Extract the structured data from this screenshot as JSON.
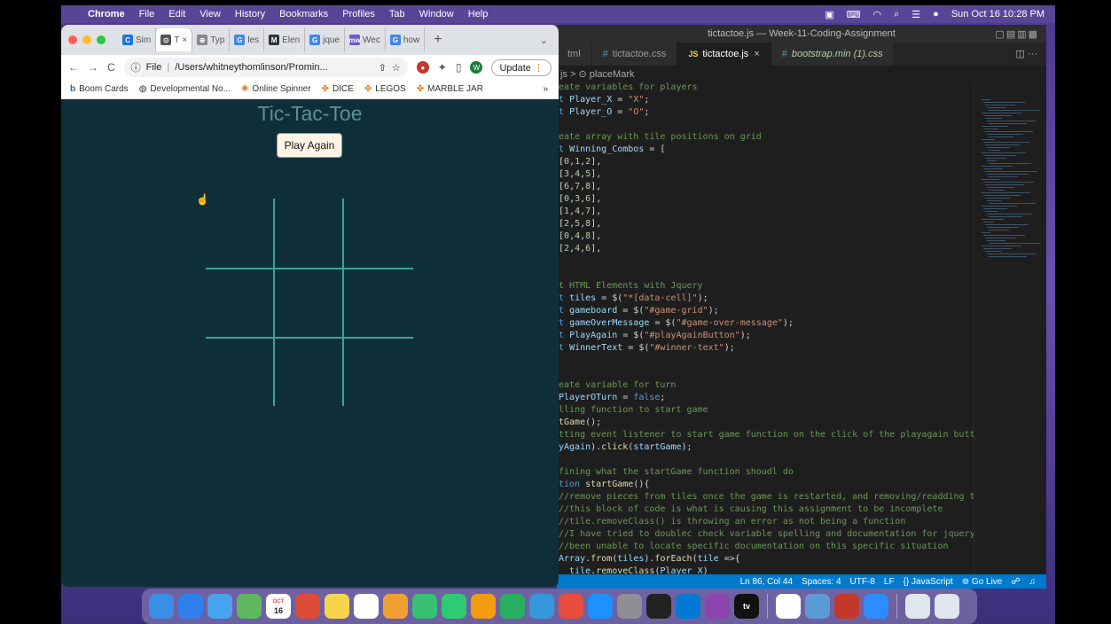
{
  "menubar": {
    "app": "Chrome",
    "items": [
      "File",
      "Edit",
      "View",
      "History",
      "Bookmarks",
      "Profiles",
      "Tab",
      "Window",
      "Help"
    ],
    "datetime": "Sun Oct 16  10:28 PM"
  },
  "vscode": {
    "window_title": "tictactoe.js — Week-11-Coding-Assignment",
    "tabs": [
      {
        "label": "tml",
        "active": false
      },
      {
        "label": "tictactoe.css",
        "active": false
      },
      {
        "label": "tictactoe.js",
        "active": true
      },
      {
        "label": "bootstrap.min (1).css",
        "active": false
      }
    ],
    "breadcrumb": "js > ⊙ placeMark",
    "code_lines": [
      "eate variables for players",
      "t Player_X = \"X\";",
      "t Player_O = \"O\";",
      "",
      "eate array with tile positions on grid",
      "t Winning_Combos = [",
      "[0,1,2],",
      "[3,4,5],",
      "[6,7,8],",
      "[0,3,6],",
      "[1,4,7],",
      "[2,5,8],",
      "[0,4,8],",
      "[2,4,6],",
      "",
      "",
      "t HTML Elements with Jquery",
      "t tiles = $(\"*[data-cell]\");",
      "t gameboard = $(\"#game-grid\");",
      "t gameOverMessage = $(\"#game-over-message\");",
      "t PlayAgain = $(\"#playAgainButton\");",
      "t WinnerText = $(\"#winner-text\");",
      "",
      "",
      "eate variable for turn",
      "PlayerOTurn = false;",
      "lling function to start game",
      "tGame();",
      "tting event listener to start game function on the click of the playagain button",
      "yAgain).click(startGame);",
      "",
      "fining what the startGame function shoudl do",
      "tion startGame(){",
      "//remove pieces from tiles once the game is restarted, and removing/readding the ev",
      "//this block of code is what is causing this assignment to be incomplete",
      "//tile.removeClass() is throwing an error as not being a function",
      "//I have tried to doublec check variable spelling and documentation for jquery ~ bu",
      "//been unable to locate specific documentation on this specific situation",
      "Array.from(tiles).forEach(tile =>{",
      "  tile.removeClass(Player_X)"
    ],
    "status": {
      "position": "Ln 86, Col 44",
      "spaces": "Spaces: 4",
      "encoding": "UTF-8",
      "eol": "LF",
      "language": "{} JavaScript",
      "golive": "Go Live"
    }
  },
  "chrome": {
    "tabs": [
      {
        "label": "Sim",
        "fav": "C",
        "color": "#1a73e8"
      },
      {
        "label": "T",
        "fav": "⊙",
        "color": "#555",
        "active": true
      },
      {
        "label": "Typ",
        "fav": "⊕",
        "color": "#888"
      },
      {
        "label": "les",
        "fav": "G",
        "color": "#4285f4"
      },
      {
        "label": "Elen",
        "fav": "M",
        "color": "#333"
      },
      {
        "label": "jque",
        "fav": "G",
        "color": "#4285f4"
      },
      {
        "label": "Wec",
        "fav": "mw",
        "color": "#6a5acd"
      },
      {
        "label": "how",
        "fav": "G",
        "color": "#4285f4"
      }
    ],
    "omnibox": {
      "scheme": "File",
      "path": "/Users/whitneythomlinson/Promin..."
    },
    "profile_initial": "W",
    "update_label": "Update",
    "bookmarks": [
      "Boom Cards",
      "Developmental No...",
      "Online Spinner",
      "DICE",
      "LEGOS",
      "MARBLE JAR"
    ],
    "page": {
      "title": "Tic-Tac-Toe",
      "play_again": "Play Again"
    }
  },
  "colors": {
    "page_bg": "#0f2f38",
    "grid_line": "#3aa597",
    "title_color": "#5d8e9a",
    "vscode_status": "#007acc"
  },
  "dock": {
    "icons": [
      "finder-icon",
      "safari-icon",
      "mail-icon",
      "maps-icon",
      "calendar-icon",
      "chrome-icon",
      "notes-icon",
      "reminders-icon",
      "photos-icon",
      "messages-icon",
      "facetime-icon",
      "pages-icon",
      "numbers-icon",
      "keynote-icon",
      "news-icon",
      "appstore-icon",
      "settings-icon",
      "terminal-icon",
      "vscode-icon",
      "podcasts-icon",
      "tv-icon",
      "slack-icon",
      "preview-icon",
      "screen-icon",
      "zoom-icon",
      "downloads-icon",
      "trash-icon"
    ],
    "calendar_month": "OCT",
    "calendar_day": "16",
    "tv_label": "tv"
  }
}
